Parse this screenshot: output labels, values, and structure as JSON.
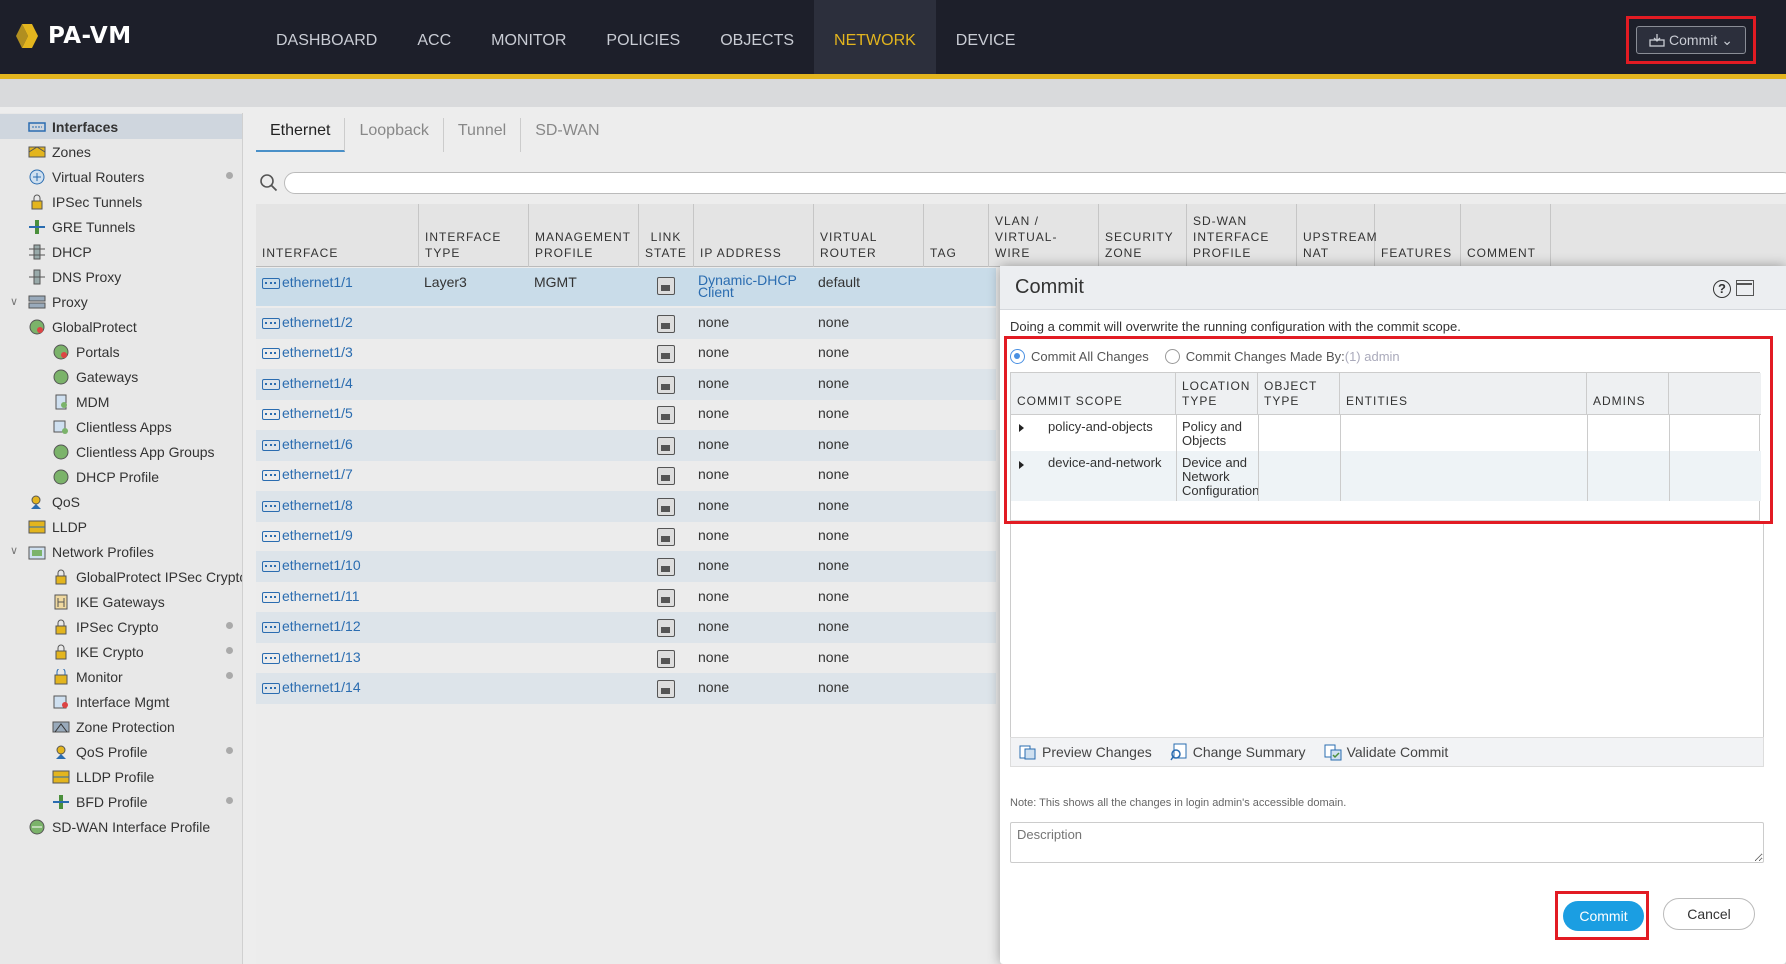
{
  "app": {
    "brand": "PA-VM"
  },
  "nav": {
    "items": [
      "DASHBOARD",
      "ACC",
      "MONITOR",
      "POLICIES",
      "OBJECTS",
      "NETWORK",
      "DEVICE"
    ],
    "active": "NETWORK",
    "commit_label": "Commit"
  },
  "sidebar": {
    "items": [
      {
        "label": "Interfaces",
        "selected": true
      },
      {
        "label": "Zones"
      },
      {
        "label": "Virtual Routers"
      },
      {
        "label": "IPSec Tunnels"
      },
      {
        "label": "GRE Tunnels"
      },
      {
        "label": "DHCP"
      },
      {
        "label": "DNS Proxy"
      },
      {
        "label": "Proxy"
      },
      {
        "label": "GlobalProtect"
      },
      {
        "label": "Portals"
      },
      {
        "label": "Gateways"
      },
      {
        "label": "MDM"
      },
      {
        "label": "Clientless Apps"
      },
      {
        "label": "Clientless App Groups"
      },
      {
        "label": "DHCP Profile"
      },
      {
        "label": "QoS"
      },
      {
        "label": "LLDP"
      },
      {
        "label": "Network Profiles"
      },
      {
        "label": "GlobalProtect IPSec Crypto"
      },
      {
        "label": "IKE Gateways"
      },
      {
        "label": "IPSec Crypto"
      },
      {
        "label": "IKE Crypto"
      },
      {
        "label": "Monitor"
      },
      {
        "label": "Interface Mgmt"
      },
      {
        "label": "Zone Protection"
      },
      {
        "label": "QoS Profile"
      },
      {
        "label": "LLDP Profile"
      },
      {
        "label": "BFD Profile"
      },
      {
        "label": "SD-WAN Interface Profile"
      }
    ]
  },
  "tabs": [
    "Ethernet",
    "Loopback",
    "Tunnel",
    "SD-WAN"
  ],
  "grid": {
    "headers": {
      "interface": "INTERFACE",
      "type": "INTERFACE TYPE",
      "mgmt": "MANAGEMENT PROFILE",
      "link": "LINK STATE",
      "ip": "IP ADDRESS",
      "vr": "VIRTUAL ROUTER",
      "tag": "TAG",
      "vlan": "VLAN / VIRTUAL-WIRE",
      "zone": "SECURITY ZONE",
      "sdwan": "SD-WAN INTERFACE PROFILE",
      "nat": "UPSTREAM NAT",
      "features": "FEATURES",
      "comment": "COMMENT"
    },
    "rows": [
      {
        "name": "ethernet1/1",
        "type": "Layer3",
        "mgmt": "MGMT",
        "ip": "Dynamic-DHCP Client",
        "vr": "default"
      },
      {
        "name": "ethernet1/2",
        "type": "",
        "mgmt": "",
        "ip": "none",
        "vr": "none"
      },
      {
        "name": "ethernet1/3",
        "type": "",
        "mgmt": "",
        "ip": "none",
        "vr": "none"
      },
      {
        "name": "ethernet1/4",
        "type": "",
        "mgmt": "",
        "ip": "none",
        "vr": "none"
      },
      {
        "name": "ethernet1/5",
        "type": "",
        "mgmt": "",
        "ip": "none",
        "vr": "none"
      },
      {
        "name": "ethernet1/6",
        "type": "",
        "mgmt": "",
        "ip": "none",
        "vr": "none"
      },
      {
        "name": "ethernet1/7",
        "type": "",
        "mgmt": "",
        "ip": "none",
        "vr": "none"
      },
      {
        "name": "ethernet1/8",
        "type": "",
        "mgmt": "",
        "ip": "none",
        "vr": "none"
      },
      {
        "name": "ethernet1/9",
        "type": "",
        "mgmt": "",
        "ip": "none",
        "vr": "none"
      },
      {
        "name": "ethernet1/10",
        "type": "",
        "mgmt": "",
        "ip": "none",
        "vr": "none"
      },
      {
        "name": "ethernet1/11",
        "type": "",
        "mgmt": "",
        "ip": "none",
        "vr": "none"
      },
      {
        "name": "ethernet1/12",
        "type": "",
        "mgmt": "",
        "ip": "none",
        "vr": "none"
      },
      {
        "name": "ethernet1/13",
        "type": "",
        "mgmt": "",
        "ip": "none",
        "vr": "none"
      },
      {
        "name": "ethernet1/14",
        "type": "",
        "mgmt": "",
        "ip": "none",
        "vr": "none"
      }
    ]
  },
  "modal": {
    "title": "Commit",
    "description": "Doing a commit will overwrite the running configuration with the commit scope.",
    "radio_all": "Commit All Changes",
    "radio_by": "Commit Changes Made By:",
    "radio_by_admin": "(1) admin",
    "scope_headers": {
      "scope": "COMMIT SCOPE",
      "location": "LOCATION TYPE",
      "object": "OBJECT TYPE",
      "entities": "ENTITIES",
      "admins": "ADMINS"
    },
    "scope_rows": [
      {
        "scope": "policy-and-objects",
        "location": "Policy and Objects"
      },
      {
        "scope": "device-and-network",
        "location": "Device and Network Configuration"
      }
    ],
    "actions": {
      "preview": "Preview Changes",
      "summary": "Change Summary",
      "validate": "Validate Commit"
    },
    "note": "Note: This shows all the changes in login admin's accessible domain.",
    "description_placeholder": "Description",
    "commit_btn": "Commit",
    "cancel_btn": "Cancel"
  },
  "colors": {
    "accent": "#e3b51e",
    "topbar": "#1d1f2a",
    "highlight": "#e21b23",
    "primary_button": "#1b9ee2",
    "link": "#2a6cb0"
  }
}
